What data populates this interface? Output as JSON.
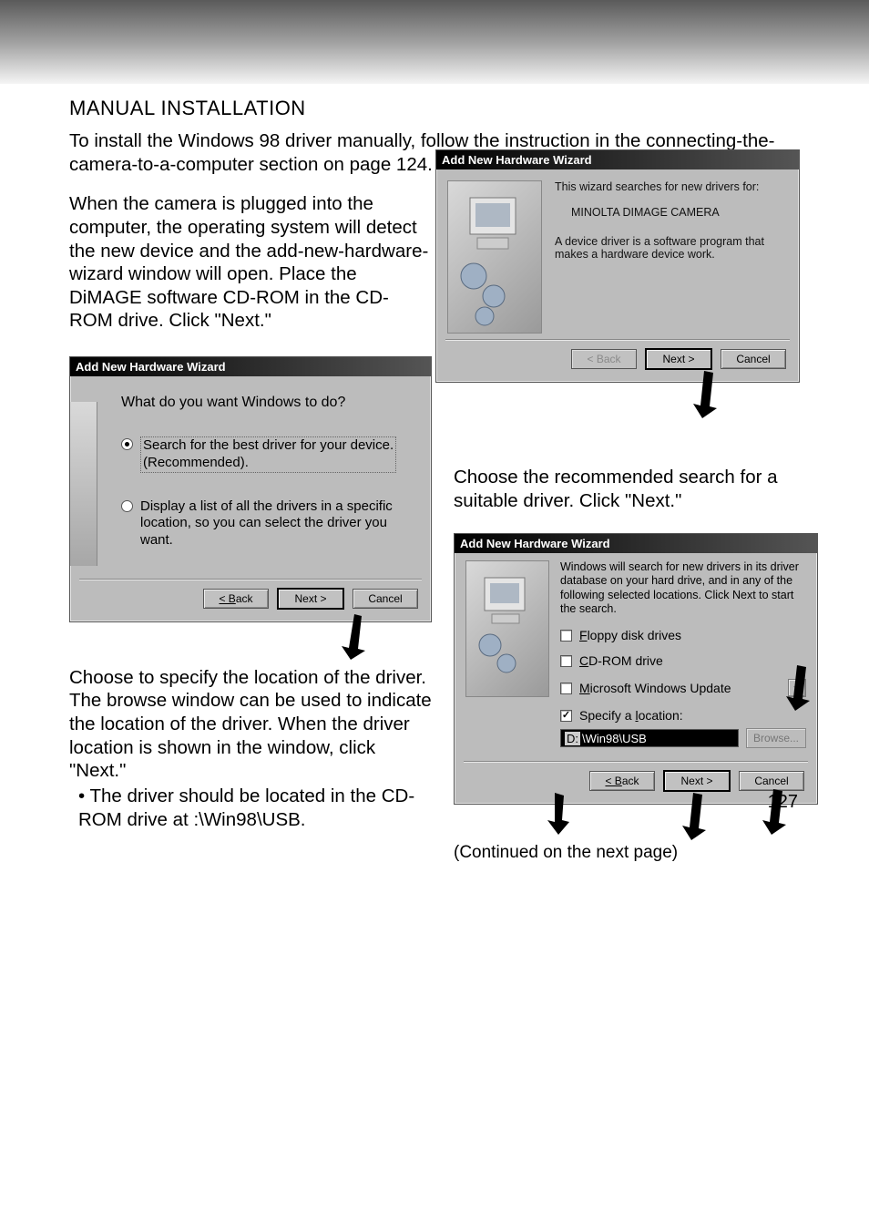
{
  "page": {
    "section_title": "MANUAL INSTALLATION",
    "intro": "To install the Windows 98 driver manually, follow the instruction in the connecting-the-camera-to-a-computer section on page 124.",
    "para_when_plugged": "When the camera is plugged into the computer, the operating system will detect the new device and the add-new-hardware-wizard window will open. Place the DiMAGE software CD-ROM in the CD-ROM drive. Click \"Next.\"",
    "para_choose_recommended": "Choose the recommended search for a suitable driver. Click \"Next.\"",
    "para_specify_location": "Choose to specify the location of the driver. The browse window can be used to indicate the location of the driver. When the driver location is shown in the window, click \"Next.\"",
    "bullet_driver_location": "• The driver should be located in the CD-ROM drive at :\\Win98\\USB.",
    "continued": "(Continued on the next page)",
    "page_number": "127"
  },
  "dialog_common": {
    "title": "Add New Hardware Wizard",
    "back": "< Back",
    "next": "Next >",
    "cancel": "Cancel"
  },
  "dialog_step1": {
    "line1": "This wizard searches for new drivers for:",
    "device": "MINOLTA DIMAGE CAMERA",
    "line2": "A device driver is a software program that makes a hardware device work."
  },
  "dialog_step2": {
    "question": "What do you want Windows to do?",
    "opt1_a": "Search for the best driver for your device.",
    "opt1_b": "(Recommended).",
    "opt2": "Display a list of all the drivers in a specific location, so you can select the driver you want."
  },
  "dialog_step3": {
    "desc": "Windows will search for new drivers in its driver database on your hard drive, and in any of the following selected locations. Click Next to start the search.",
    "floppy": "Floppy disk drives",
    "cdrom": "CD-ROM drive",
    "msupdate": "Microsoft Windows Update",
    "specify": "Specify a location:",
    "path_prefix": "D:",
    "path_rest": "\\Win98\\USB",
    "browse": "Browse..."
  }
}
